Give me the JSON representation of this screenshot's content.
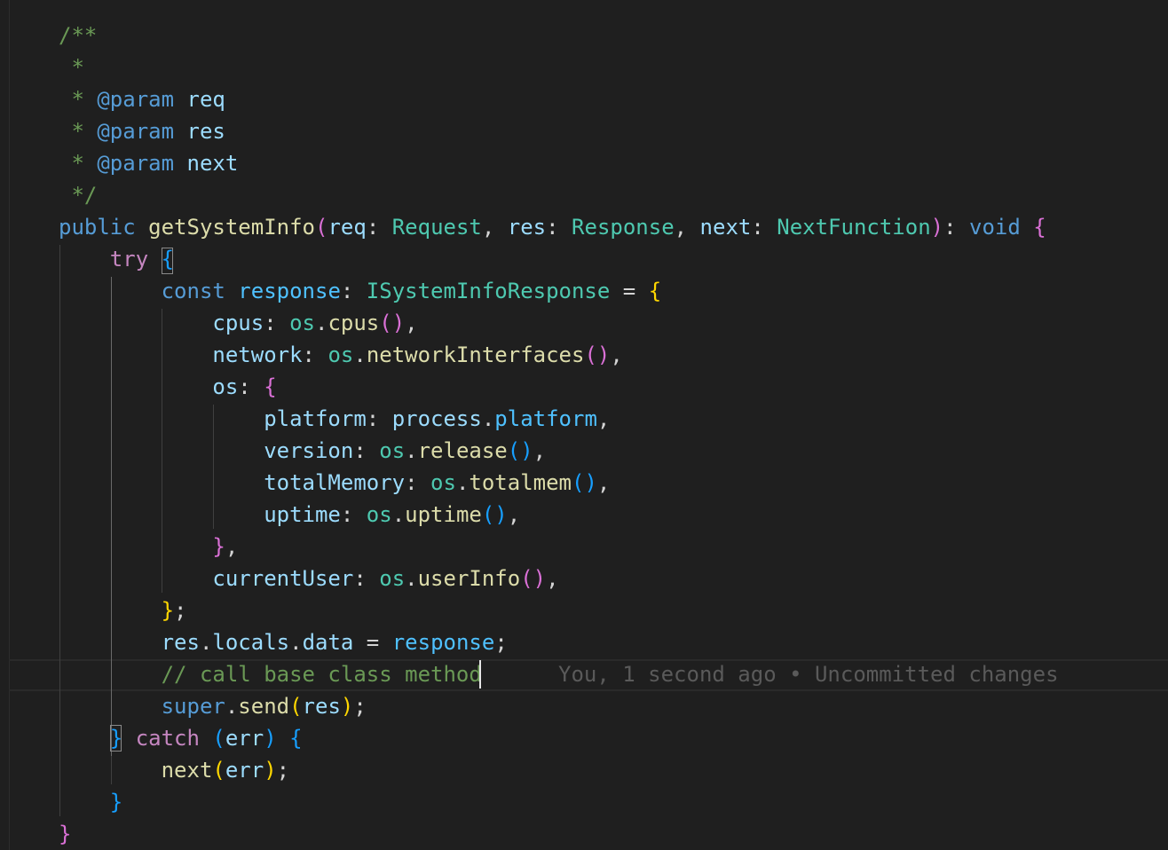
{
  "editor": {
    "colors": {
      "background": "#1f1f1f",
      "comment": "#6a9955",
      "keyword_blue": "#569cd6",
      "keyword_control": "#c586c0",
      "function": "#dcdcaa",
      "variable": "#9cdcfe",
      "type": "#4ec9b0",
      "bracket_gold": "#ffd700",
      "bracket_pink": "#da70d6",
      "bracket_blue": "#179fff",
      "blame": "#5a5a5a"
    },
    "blame": {
      "text": "You, 1 second ago • Uncommitted changes"
    },
    "lines": [
      {
        "tokens": [
          {
            "t": "/**",
            "c": "#6a9955"
          }
        ]
      },
      {
        "tokens": [
          {
            "t": " *",
            "c": "#6a9955"
          }
        ]
      },
      {
        "tokens": [
          {
            "t": " * ",
            "c": "#6a9955"
          },
          {
            "t": "@param",
            "c": "#569cd6"
          },
          {
            "t": " ",
            "c": "#6a9955"
          },
          {
            "t": "req",
            "c": "#9cdcfe"
          }
        ]
      },
      {
        "tokens": [
          {
            "t": " * ",
            "c": "#6a9955"
          },
          {
            "t": "@param",
            "c": "#569cd6"
          },
          {
            "t": " ",
            "c": "#6a9955"
          },
          {
            "t": "res",
            "c": "#9cdcfe"
          }
        ]
      },
      {
        "tokens": [
          {
            "t": " * ",
            "c": "#6a9955"
          },
          {
            "t": "@param",
            "c": "#569cd6"
          },
          {
            "t": " ",
            "c": "#6a9955"
          },
          {
            "t": "next",
            "c": "#9cdcfe"
          }
        ]
      },
      {
        "tokens": [
          {
            "t": " */",
            "c": "#6a9955"
          }
        ]
      },
      {
        "tokens": [
          {
            "t": "public",
            "c": "#569cd6"
          },
          {
            "t": " ",
            "c": "#d4d4d4"
          },
          {
            "t": "getSystemInfo",
            "c": "#dcdcaa"
          },
          {
            "t": "(",
            "c": "#da70d6"
          },
          {
            "t": "req",
            "c": "#9cdcfe"
          },
          {
            "t": ": ",
            "c": "#d4d4d4"
          },
          {
            "t": "Request",
            "c": "#4ec9b0"
          },
          {
            "t": ", ",
            "c": "#d4d4d4"
          },
          {
            "t": "res",
            "c": "#9cdcfe"
          },
          {
            "t": ": ",
            "c": "#d4d4d4"
          },
          {
            "t": "Response",
            "c": "#4ec9b0"
          },
          {
            "t": ", ",
            "c": "#d4d4d4"
          },
          {
            "t": "next",
            "c": "#9cdcfe"
          },
          {
            "t": ": ",
            "c": "#d4d4d4"
          },
          {
            "t": "NextFunction",
            "c": "#4ec9b0"
          },
          {
            "t": ")",
            "c": "#da70d6"
          },
          {
            "t": ": ",
            "c": "#d4d4d4"
          },
          {
            "t": "void",
            "c": "#569cd6"
          },
          {
            "t": " ",
            "c": "#d4d4d4"
          },
          {
            "t": "{",
            "c": "#da70d6"
          }
        ]
      },
      {
        "tokens": [
          {
            "t": "    ",
            "c": "#d4d4d4"
          },
          {
            "t": "try",
            "c": "#c586c0"
          },
          {
            "t": " ",
            "c": "#d4d4d4"
          },
          {
            "t": "{",
            "c": "#179fff"
          }
        ]
      },
      {
        "tokens": [
          {
            "t": "        ",
            "c": "#d4d4d4"
          },
          {
            "t": "const",
            "c": "#569cd6"
          },
          {
            "t": " ",
            "c": "#d4d4d4"
          },
          {
            "t": "response",
            "c": "#4fc1ff"
          },
          {
            "t": ": ",
            "c": "#d4d4d4"
          },
          {
            "t": "ISystemInfoResponse",
            "c": "#4ec9b0"
          },
          {
            "t": " = ",
            "c": "#d4d4d4"
          },
          {
            "t": "{",
            "c": "#ffd700"
          }
        ]
      },
      {
        "tokens": [
          {
            "t": "            ",
            "c": "#d4d4d4"
          },
          {
            "t": "cpus",
            "c": "#9cdcfe"
          },
          {
            "t": ": ",
            "c": "#d4d4d4"
          },
          {
            "t": "os",
            "c": "#4ec9b0"
          },
          {
            "t": ".",
            "c": "#d4d4d4"
          },
          {
            "t": "cpus",
            "c": "#dcdcaa"
          },
          {
            "t": "()",
            "c": "#da70d6"
          },
          {
            "t": ",",
            "c": "#d4d4d4"
          }
        ]
      },
      {
        "tokens": [
          {
            "t": "            ",
            "c": "#d4d4d4"
          },
          {
            "t": "network",
            "c": "#9cdcfe"
          },
          {
            "t": ": ",
            "c": "#d4d4d4"
          },
          {
            "t": "os",
            "c": "#4ec9b0"
          },
          {
            "t": ".",
            "c": "#d4d4d4"
          },
          {
            "t": "networkInterfaces",
            "c": "#dcdcaa"
          },
          {
            "t": "()",
            "c": "#da70d6"
          },
          {
            "t": ",",
            "c": "#d4d4d4"
          }
        ]
      },
      {
        "tokens": [
          {
            "t": "            ",
            "c": "#d4d4d4"
          },
          {
            "t": "os",
            "c": "#9cdcfe"
          },
          {
            "t": ": ",
            "c": "#d4d4d4"
          },
          {
            "t": "{",
            "c": "#da70d6"
          }
        ]
      },
      {
        "tokens": [
          {
            "t": "                ",
            "c": "#d4d4d4"
          },
          {
            "t": "platform",
            "c": "#9cdcfe"
          },
          {
            "t": ": ",
            "c": "#d4d4d4"
          },
          {
            "t": "process",
            "c": "#9cdcfe"
          },
          {
            "t": ".",
            "c": "#d4d4d4"
          },
          {
            "t": "platform",
            "c": "#4fc1ff"
          },
          {
            "t": ",",
            "c": "#d4d4d4"
          }
        ]
      },
      {
        "tokens": [
          {
            "t": "                ",
            "c": "#d4d4d4"
          },
          {
            "t": "version",
            "c": "#9cdcfe"
          },
          {
            "t": ": ",
            "c": "#d4d4d4"
          },
          {
            "t": "os",
            "c": "#4ec9b0"
          },
          {
            "t": ".",
            "c": "#d4d4d4"
          },
          {
            "t": "release",
            "c": "#dcdcaa"
          },
          {
            "t": "()",
            "c": "#179fff"
          },
          {
            "t": ",",
            "c": "#d4d4d4"
          }
        ]
      },
      {
        "tokens": [
          {
            "t": "                ",
            "c": "#d4d4d4"
          },
          {
            "t": "totalMemory",
            "c": "#9cdcfe"
          },
          {
            "t": ": ",
            "c": "#d4d4d4"
          },
          {
            "t": "os",
            "c": "#4ec9b0"
          },
          {
            "t": ".",
            "c": "#d4d4d4"
          },
          {
            "t": "totalmem",
            "c": "#dcdcaa"
          },
          {
            "t": "()",
            "c": "#179fff"
          },
          {
            "t": ",",
            "c": "#d4d4d4"
          }
        ]
      },
      {
        "tokens": [
          {
            "t": "                ",
            "c": "#d4d4d4"
          },
          {
            "t": "uptime",
            "c": "#9cdcfe"
          },
          {
            "t": ": ",
            "c": "#d4d4d4"
          },
          {
            "t": "os",
            "c": "#4ec9b0"
          },
          {
            "t": ".",
            "c": "#d4d4d4"
          },
          {
            "t": "uptime",
            "c": "#dcdcaa"
          },
          {
            "t": "()",
            "c": "#179fff"
          },
          {
            "t": ",",
            "c": "#d4d4d4"
          }
        ]
      },
      {
        "tokens": [
          {
            "t": "            ",
            "c": "#d4d4d4"
          },
          {
            "t": "}",
            "c": "#da70d6"
          },
          {
            "t": ",",
            "c": "#d4d4d4"
          }
        ]
      },
      {
        "tokens": [
          {
            "t": "            ",
            "c": "#d4d4d4"
          },
          {
            "t": "currentUser",
            "c": "#9cdcfe"
          },
          {
            "t": ": ",
            "c": "#d4d4d4"
          },
          {
            "t": "os",
            "c": "#4ec9b0"
          },
          {
            "t": ".",
            "c": "#d4d4d4"
          },
          {
            "t": "userInfo",
            "c": "#dcdcaa"
          },
          {
            "t": "()",
            "c": "#da70d6"
          },
          {
            "t": ",",
            "c": "#d4d4d4"
          }
        ]
      },
      {
        "tokens": [
          {
            "t": "        ",
            "c": "#d4d4d4"
          },
          {
            "t": "}",
            "c": "#ffd700"
          },
          {
            "t": ";",
            "c": "#d4d4d4"
          }
        ]
      },
      {
        "tokens": [
          {
            "t": "        ",
            "c": "#d4d4d4"
          },
          {
            "t": "res",
            "c": "#9cdcfe"
          },
          {
            "t": ".",
            "c": "#d4d4d4"
          },
          {
            "t": "locals",
            "c": "#9cdcfe"
          },
          {
            "t": ".",
            "c": "#d4d4d4"
          },
          {
            "t": "data",
            "c": "#9cdcfe"
          },
          {
            "t": " = ",
            "c": "#d4d4d4"
          },
          {
            "t": "response",
            "c": "#4fc1ff"
          },
          {
            "t": ";",
            "c": "#d4d4d4"
          }
        ]
      },
      {
        "tokens": [
          {
            "t": "        ",
            "c": "#d4d4d4"
          },
          {
            "t": "// call base class method",
            "c": "#6a9955"
          }
        ]
      },
      {
        "tokens": [
          {
            "t": "        ",
            "c": "#d4d4d4"
          },
          {
            "t": "super",
            "c": "#569cd6"
          },
          {
            "t": ".",
            "c": "#d4d4d4"
          },
          {
            "t": "send",
            "c": "#dcdcaa"
          },
          {
            "t": "(",
            "c": "#ffd700"
          },
          {
            "t": "res",
            "c": "#9cdcfe"
          },
          {
            "t": ")",
            "c": "#ffd700"
          },
          {
            "t": ";",
            "c": "#d4d4d4"
          }
        ]
      },
      {
        "tokens": [
          {
            "t": "    ",
            "c": "#d4d4d4"
          },
          {
            "t": "}",
            "c": "#179fff"
          },
          {
            "t": " ",
            "c": "#d4d4d4"
          },
          {
            "t": "catch",
            "c": "#c586c0"
          },
          {
            "t": " ",
            "c": "#d4d4d4"
          },
          {
            "t": "(",
            "c": "#179fff"
          },
          {
            "t": "err",
            "c": "#9cdcfe"
          },
          {
            "t": ")",
            "c": "#179fff"
          },
          {
            "t": " ",
            "c": "#d4d4d4"
          },
          {
            "t": "{",
            "c": "#179fff"
          }
        ]
      },
      {
        "tokens": [
          {
            "t": "        ",
            "c": "#d4d4d4"
          },
          {
            "t": "next",
            "c": "#dcdcaa"
          },
          {
            "t": "(",
            "c": "#ffd700"
          },
          {
            "t": "err",
            "c": "#9cdcfe"
          },
          {
            "t": ")",
            "c": "#ffd700"
          },
          {
            "t": ";",
            "c": "#d4d4d4"
          }
        ]
      },
      {
        "tokens": [
          {
            "t": "    ",
            "c": "#d4d4d4"
          },
          {
            "t": "}",
            "c": "#179fff"
          }
        ]
      },
      {
        "tokens": [
          {
            "t": "}",
            "c": "#da70d6"
          }
        ]
      }
    ]
  }
}
